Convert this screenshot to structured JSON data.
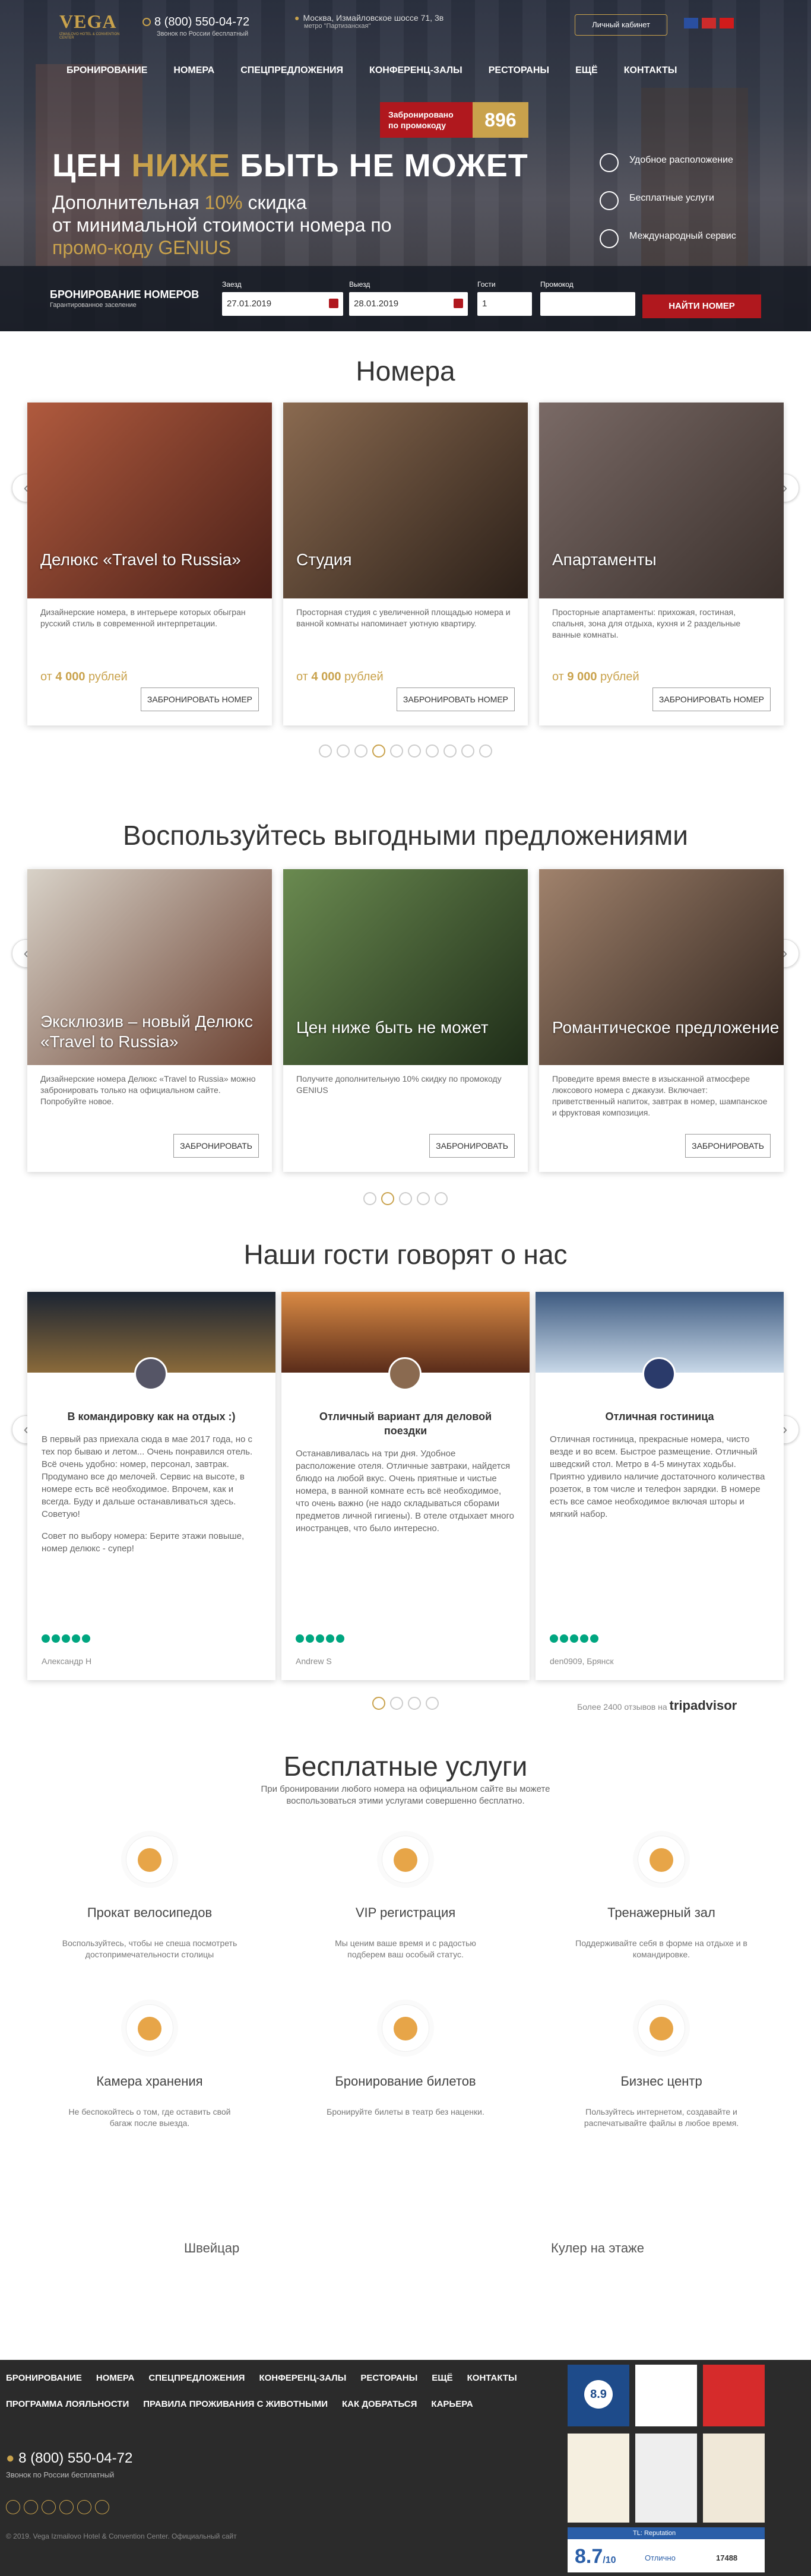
{
  "header": {
    "logo_word": "VEGA",
    "logo_sub": "Izmailovo Hotel & Convention Center",
    "phone": "8 (800) 550-04-72",
    "phone_note": "Звонок по России бесплатный",
    "address": "Москва, Измайловское шоссе 71, 3в",
    "metro": "метро \"Партизанская\"",
    "cabinet": "Личный кабинет",
    "flags": [
      {
        "color": "#2a4fa0"
      },
      {
        "color": "#cc2b2b"
      },
      {
        "color": "#d21b1b"
      }
    ]
  },
  "nav": [
    "Бронирование",
    "Номера",
    "Спецпредложения",
    "Конференц-залы",
    "Рестораны",
    "Ещё",
    "Контакты"
  ],
  "booked": {
    "label": "Забронировано по промокоду",
    "count": "896"
  },
  "hero": {
    "headline_a": "ЦЕН ",
    "headline_b": "НИЖЕ",
    "headline_c": " БЫТЬ НЕ МОЖЕТ",
    "line1_a": "Дополнительная ",
    "line1_b": "10%",
    "line1_c": " скидка",
    "line2": "от минимальной стоимости номера по",
    "line3": "промо-коду GENIUS",
    "perks": [
      "Удобное расположение",
      "Бесплатные услуги",
      "Международный сервис"
    ]
  },
  "booking": {
    "title": "БРОНИРОВАНИЕ НОМЕРОВ",
    "subtitle": "Гарантированное заселение",
    "checkin_label": "Заезд",
    "checkin": "27.01.2019",
    "checkout_label": "Выезд",
    "checkout": "28.01.2019",
    "guests_label": "Гости",
    "guests": "1",
    "promo_label": "Промокод",
    "promo": "",
    "find": "НАЙТИ НОМЕР"
  },
  "rooms": {
    "title": "Номера",
    "cards": [
      {
        "name": "Делюкс «Travel to Russia»",
        "desc": "Дизайнерские номера, в интерьере которых обыгран русский стиль в современной интерпретации.",
        "price_prefix": "от ",
        "price": "4 000",
        "price_suffix": " рублей",
        "btn": "ЗАБРОНИРОВАТЬ НОМЕР",
        "img": "#7a3b2e"
      },
      {
        "name": "Студия",
        "desc": "Просторная студия с увеличенной площадью номера и ванной комнаты напоминает уютную квартиру.",
        "price_prefix": "от ",
        "price": "4 000",
        "price_suffix": " рублей",
        "btn": "ЗАБРОНИРОВАТЬ НОМЕР",
        "img": "#4a3a2e"
      },
      {
        "name": "Апартаменты",
        "desc": "Просторные апартаменты: прихожая, гостиная, спальня, зона для отдыха, кухня и 2 раздельные ванные комнаты.",
        "price_prefix": "от ",
        "price": "9 000",
        "price_suffix": " рублей",
        "btn": "ЗАБРОНИРОВАТЬ НОМЕР",
        "img": "#5a4a44"
      }
    ],
    "dots": 10,
    "active_dot": 3
  },
  "offers": {
    "title": "Воспользуйтесь выгодными предложениями",
    "cards": [
      {
        "name": "Эксклюзив – новый Делюкс «Travel to Russia»",
        "desc": "Дизайнерские номера Делюкс «Travel to Russia» можно забронировать только на официальном сайте. Попробуйте новое.",
        "btn": "ЗАБРОНИРОВАТЬ",
        "img": "#8a7a66"
      },
      {
        "name": "Цен ниже быть не может",
        "desc": "Получите дополнительную 10% скидку по промокоду GENIUS",
        "btn": "ЗАБРОНИРОВАТЬ",
        "img": "#3f5a33"
      },
      {
        "name": "Романтическое предложение",
        "desc": "Проведите время вместе в изысканной атмосфере люксового номера с джакузи. Включает: приветственный напиток, завтрак в номер, шампанское и фруктовая композиция.",
        "btn": "ЗАБРОНИРОВАТЬ",
        "img": "#5e4a40"
      }
    ],
    "dots": 5,
    "active_dot": 1
  },
  "reviews": {
    "title": "Наши гости говорят о нас",
    "cards": [
      {
        "title": "В командировку как на отдых :)",
        "body": "В первый раз приехала сюда в мае 2017 года, но с тех пор бываю и летом... Очень понравился отель. Всё очень удобно: номер, персонал, завтрак. Продумано все до мелочей. Сервис на высоте, в номере есть всё необходимое. Впрочем, как и всегда. Буду и дальше останавливаться здесь. Советую!",
        "note": "Совет по выбору номера: Берите этажи повыше, номер делюкс - супер!",
        "author": "Александр Н",
        "img": "#1f2a3a"
      },
      {
        "title": "Отличный вариант для деловой поездки",
        "body": "Останавливалась на три дня. Удобное расположение отеля. Отличные завтраки, найдется блюдо на любой вкус. Очень приятные и чистые номера, в ванной комнате есть всё необходимое, что очень важно (не надо складываться сборами предметов личной гигиены). В отеле отдыхает много иностранцев, что было интересно.",
        "note": "",
        "author": "Andrew S",
        "img": "#c07a3a"
      },
      {
        "title": "Отличная гостиница",
        "body": "Отличная гостиница, прекрасные номера, чисто везде и во всем. Быстрое размещение. Отличный шведский стол. Метро в 4-5 минутах ходьбы. Приятно удивило наличие достаточного количества розеток, в том числе и телефон зарядки. В номере есть все самое необходимое включая шторы и мягкий набор.",
        "note": "",
        "author": "den0909, Брянск",
        "img": "#3d5a80"
      }
    ],
    "dots": 4,
    "active_dot": 0,
    "more": "Более 2400 отзывов на",
    "ta": "tripadvisor"
  },
  "services": {
    "title": "Бесплатные услуги",
    "intro": "При бронировании любого номера на официальном сайте вы можете воспользоваться этими услугами совершенно бесплатно.",
    "items": [
      {
        "name": "Прокат велосипедов",
        "desc": "Воспользуйтесь, чтобы не спеша посмотреть достопримечательности столицы"
      },
      {
        "name": "VIP регистрация",
        "desc": "Мы ценим ваше время и с радостью подберем ваш особый статус."
      },
      {
        "name": "Тренажерный зал",
        "desc": "Поддерживайте себя в форме на отдыхе и в командировке."
      },
      {
        "name": "Камера хранения",
        "desc": "Не беспокойтесь о том, где оставить свой багаж после выезда."
      },
      {
        "name": "Бронирование билетов",
        "desc": "Бронируйте билеты в театр без наценки."
      },
      {
        "name": "Бизнес центр",
        "desc": "Пользуйтесь интернетом, создавайте и распечатывайте файлы в любое время."
      }
    ],
    "extra": [
      "Швейцар",
      "Кулер на этаже"
    ]
  },
  "footer": {
    "nav1": [
      "Бронирование",
      "Номера",
      "Спецпредложения",
      "Конференц-залы",
      "Рестораны",
      "Ещё",
      "Контакты"
    ],
    "nav2": [
      "Программа лояльности",
      "Правила проживания с животными",
      "Как добраться",
      "Карьера"
    ],
    "phone": "8 (800) 550-04-72",
    "phone_note": "Звонок по России бесплатный",
    "copyright": "© 2019. Vega Izmailovo Hotel & Convention Center. Официальный сайт",
    "score": "8.7",
    "score_of": "/10",
    "score_word": "Отлично",
    "badge_score": "8.9",
    "reviews_count": "17488",
    "reputation": "TL: Reputation"
  }
}
